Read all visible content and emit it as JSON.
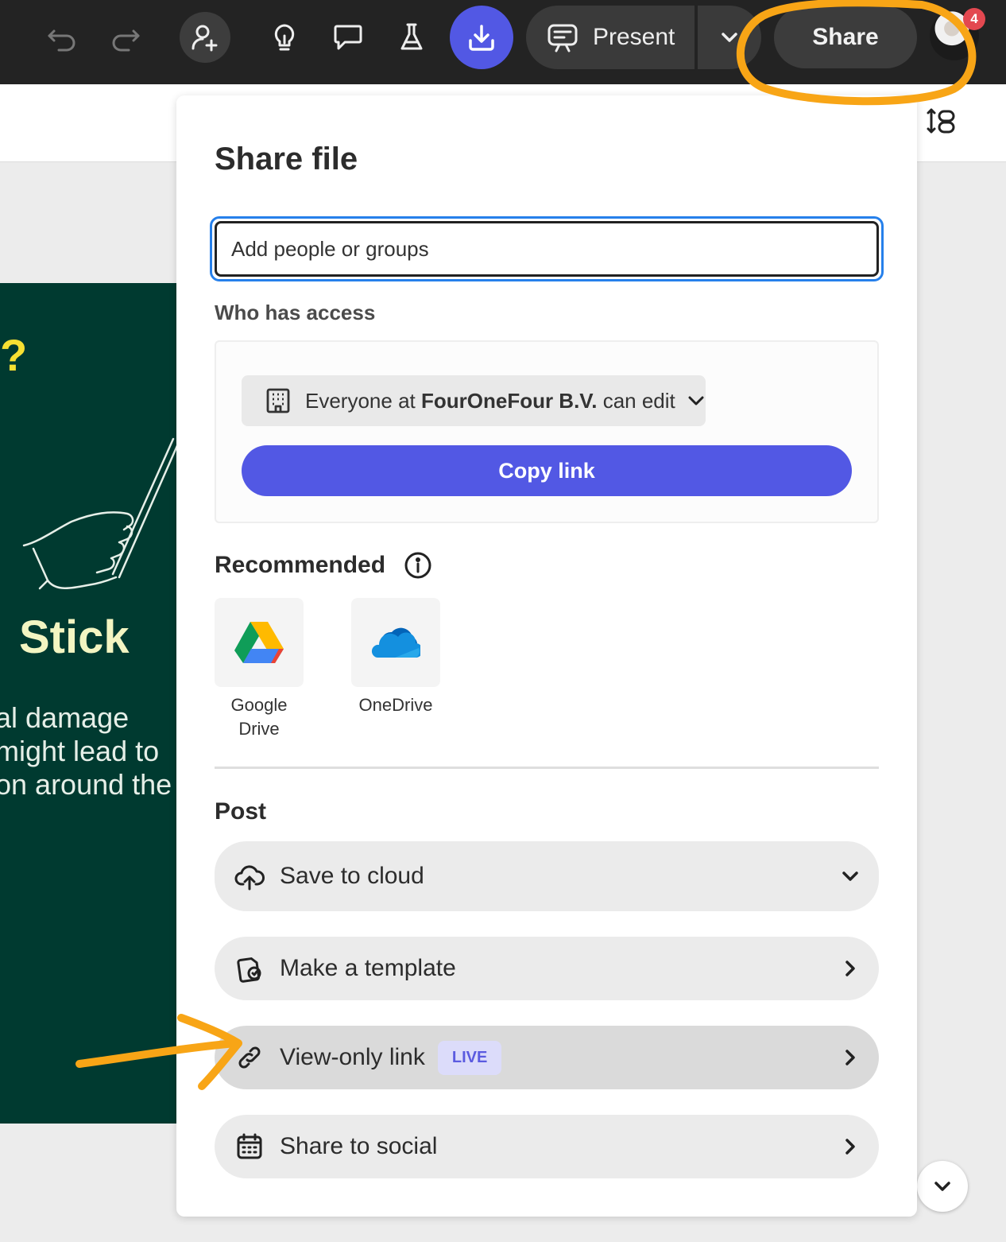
{
  "toolbar": {
    "present_label": "Present",
    "share_label": "Share",
    "notification_count": "4",
    "icons": [
      "undo-icon",
      "redo-icon",
      "invite-user-icon",
      "lightbulb-icon",
      "comment-icon",
      "flask-icon",
      "download-icon",
      "present-icon",
      "chevron-down-icon"
    ]
  },
  "canvas": {
    "slide_question": "?",
    "slide_heading": "Stick",
    "slide_lines": [
      "al damage",
      " might lead to",
      "on around the"
    ]
  },
  "share_panel": {
    "title": "Share file",
    "input_placeholder": "Add people or groups",
    "who_has_access_label": "Who has access",
    "access_prefix": "Everyone at ",
    "access_org": "FourOneFour B.V.",
    "access_suffix": " can edit",
    "copy_link_label": "Copy link",
    "recommended_label": "Recommended",
    "recommended": [
      {
        "label": "Google\nDrive",
        "icon": "google-drive-icon"
      },
      {
        "label": "OneDrive",
        "icon": "onedrive-icon"
      }
    ],
    "post_label": "Post",
    "post_items": [
      {
        "label": "Save to cloud",
        "icon": "cloud-upload-icon",
        "chevron": "down"
      },
      {
        "label": "Make a template",
        "icon": "template-icon",
        "chevron": "right"
      },
      {
        "label": "View-only link",
        "icon": "link-icon",
        "chevron": "right",
        "badge": "LIVE"
      },
      {
        "label": "Share to social",
        "icon": "calendar-icon",
        "chevron": "right"
      }
    ]
  },
  "colors": {
    "toolbar_bg": "#232323",
    "accent": "#5258e4",
    "annotation": "#f8a516",
    "slide_bg": "#003a30",
    "notification": "#e34850"
  }
}
